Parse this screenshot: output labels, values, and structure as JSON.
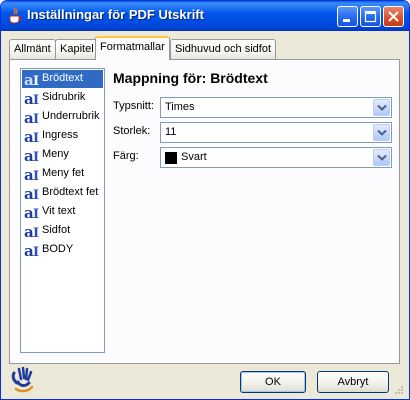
{
  "window": {
    "title": "Inställningar för PDF Utskrift"
  },
  "tabs": [
    {
      "label": "Allmänt"
    },
    {
      "label": "Kapitel"
    },
    {
      "label": "Formatmallar",
      "active": true
    },
    {
      "label": "Sidhuvud och sidfot"
    }
  ],
  "styles": {
    "selected_index": 0,
    "items": [
      {
        "label": "Brödtext"
      },
      {
        "label": "Sidrubrik"
      },
      {
        "label": "Underrubrik"
      },
      {
        "label": "Ingress"
      },
      {
        "label": "Meny"
      },
      {
        "label": "Meny fet"
      },
      {
        "label": "Brödtext fet"
      },
      {
        "label": "Vit text"
      },
      {
        "label": "Sidfot"
      },
      {
        "label": "BODY"
      }
    ],
    "icon": "font-style-icon"
  },
  "mapping": {
    "title": "Mappning för: Brödtext",
    "font_label": "Typsnitt:",
    "font_value": "Times",
    "size_label": "Storlek:",
    "size_value": "11",
    "color_label": "Färg:",
    "color_value": "Svart",
    "color_swatch": "#000000"
  },
  "buttons": {
    "ok": "OK",
    "cancel": "Avbryt"
  },
  "colors": {
    "titlebar": "#0058ee",
    "selection": "#316ac5",
    "active_tab_accent": "#ffc83c"
  }
}
